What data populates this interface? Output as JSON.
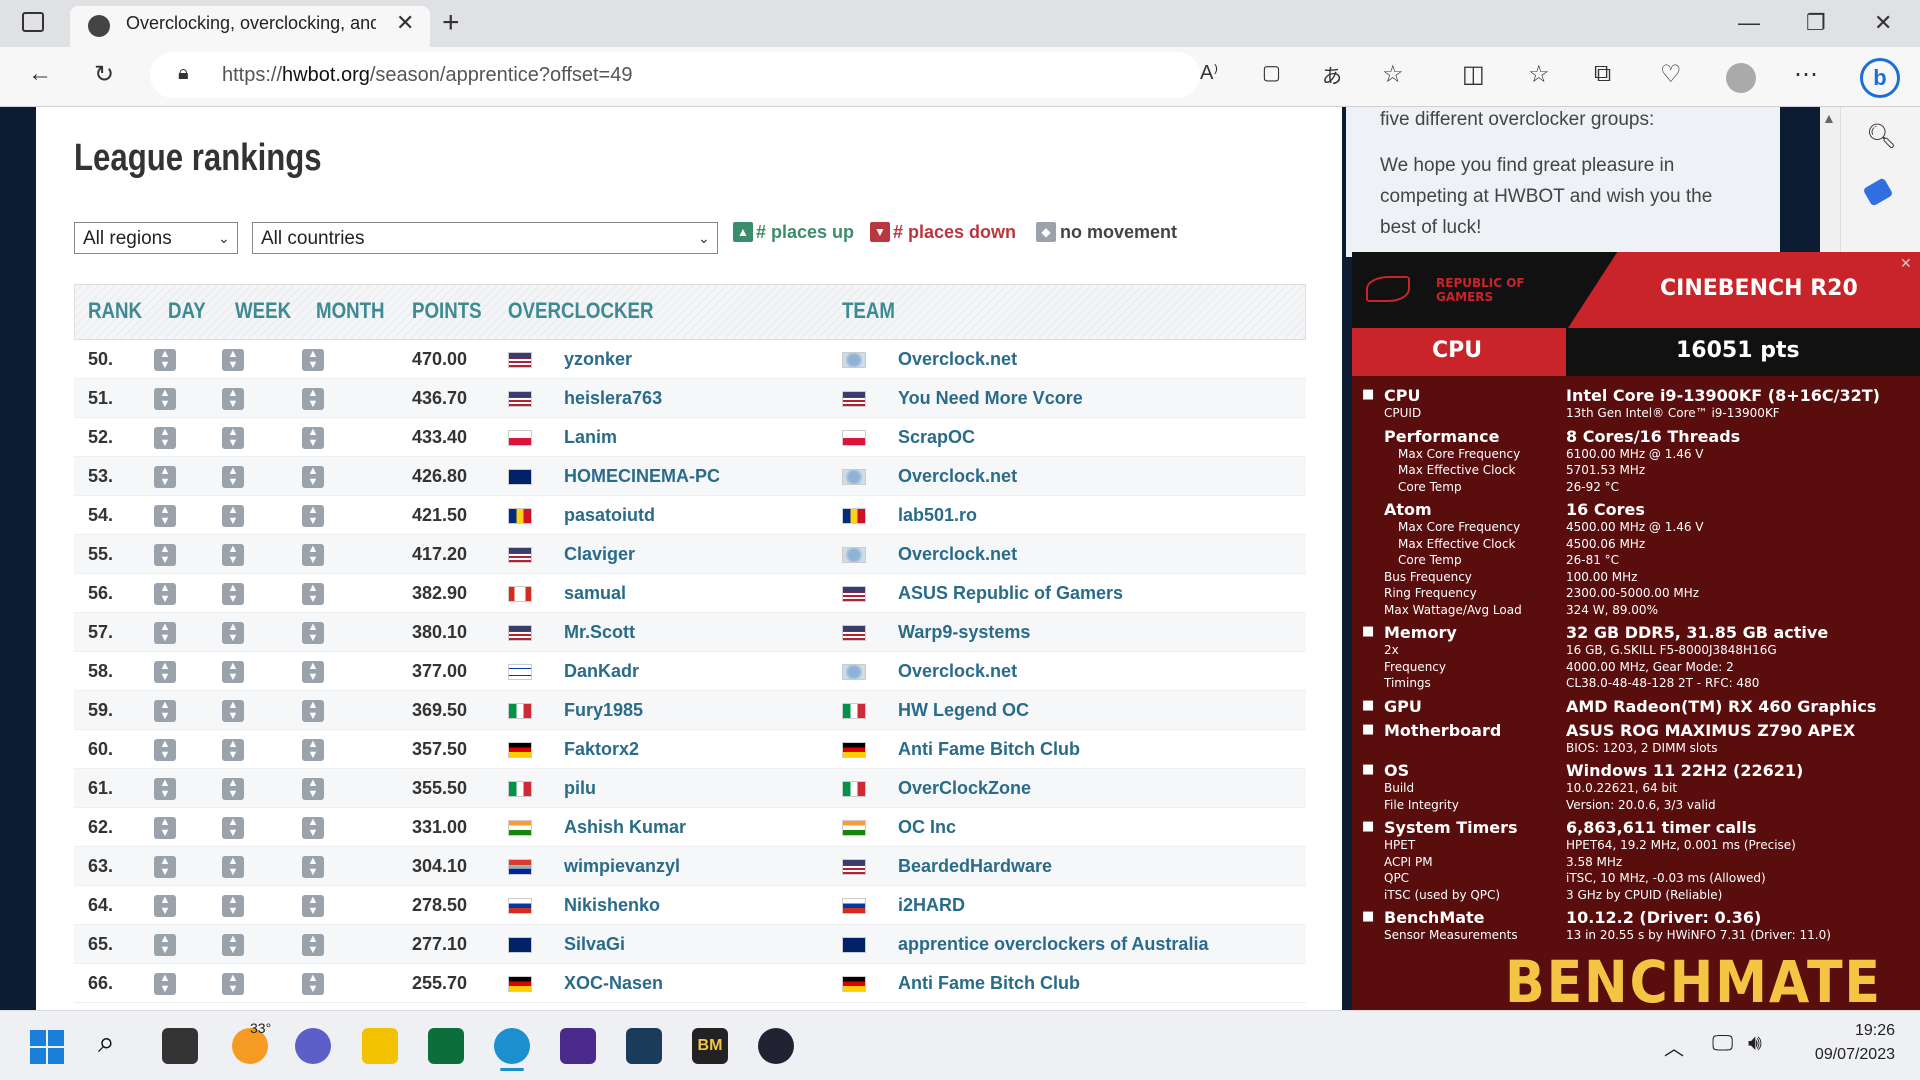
{
  "browser": {
    "tab_title": "Overclocking, overclocking, and more",
    "url_prefix": "https://",
    "url_domain": "hwbot.org",
    "url_path": "/season/apprentice?offset=49"
  },
  "page": {
    "title": "League rankings",
    "regions_select": "All regions",
    "countries_select": "All countries",
    "legend_up": "# places up",
    "legend_down": "# places down",
    "legend_none": "no movement",
    "right_text_1": "five different overclocker groups:",
    "right_text_2": "We hope you find great pleasure in",
    "right_text_3": "competing at HWBOT and wish you the",
    "right_text_4": "best of luck!"
  },
  "table": {
    "headers": {
      "rank": "RANK",
      "day": "DAY",
      "week": "WEEK",
      "month": "MONTH",
      "points": "POINTS",
      "overclocker": "OVERCLOCKER",
      "team": "TEAM"
    },
    "rows": [
      {
        "rank": "50.",
        "points": "470.00",
        "name": "yzonker",
        "team": "Overclock.net",
        "flag": "us",
        "tflag": "world"
      },
      {
        "rank": "51.",
        "points": "436.70",
        "name": "heislera763",
        "team": "You Need More Vcore",
        "flag": "us",
        "tflag": "us"
      },
      {
        "rank": "52.",
        "points": "433.40",
        "name": "Lanim",
        "team": "ScrapOC",
        "flag": "pl",
        "tflag": "pl"
      },
      {
        "rank": "53.",
        "points": "426.80",
        "name": "HOMECINEMA-PC",
        "team": "Overclock.net",
        "flag": "au",
        "tflag": "world"
      },
      {
        "rank": "54.",
        "points": "421.50",
        "name": "pasatoiutd",
        "team": "lab501.ro",
        "flag": "ro",
        "tflag": "ro"
      },
      {
        "rank": "55.",
        "points": "417.20",
        "name": "Claviger",
        "team": "Overclock.net",
        "flag": "us",
        "tflag": "world"
      },
      {
        "rank": "56.",
        "points": "382.90",
        "name": "samual",
        "team": "ASUS Republic of Gamers",
        "flag": "ca",
        "tflag": "us"
      },
      {
        "rank": "57.",
        "points": "380.10",
        "name": "Mr.Scott",
        "team": "Warp9-systems",
        "flag": "us",
        "tflag": "us"
      },
      {
        "rank": "58.",
        "points": "377.00",
        "name": "DanKadr",
        "team": "Overclock.net",
        "flag": "il",
        "tflag": "world"
      },
      {
        "rank": "59.",
        "points": "369.50",
        "name": "Fury1985",
        "team": "HW Legend OC",
        "flag": "it",
        "tflag": "it"
      },
      {
        "rank": "60.",
        "points": "357.50",
        "name": "Faktorx2",
        "team": "Anti Fame Bitch Club",
        "flag": "de",
        "tflag": "de"
      },
      {
        "rank": "61.",
        "points": "355.50",
        "name": "pilu",
        "team": "OverClockZone",
        "flag": "it",
        "tflag": "it"
      },
      {
        "rank": "62.",
        "points": "331.00",
        "name": "Ashish Kumar",
        "team": "OC Inc",
        "flag": "in",
        "tflag": "in"
      },
      {
        "rank": "63.",
        "points": "304.10",
        "name": "wimpievanzyl",
        "team": "BeardedHardware",
        "flag": "za",
        "tflag": "us"
      },
      {
        "rank": "64.",
        "points": "278.50",
        "name": "Nikishenko",
        "team": "i2HARD",
        "flag": "ru",
        "tflag": "ru"
      },
      {
        "rank": "65.",
        "points": "277.10",
        "name": "SilvaGi",
        "team": "apprentice overclockers of Australia",
        "flag": "au",
        "tflag": "au"
      },
      {
        "rank": "66.",
        "points": "255.70",
        "name": "XOC-Nasen",
        "team": "Anti Fame Bitch Club",
        "flag": "de",
        "tflag": "de"
      }
    ]
  },
  "benchmate": {
    "rog_line1": "REPUBLIC OF",
    "rog_line2": "GAMERS",
    "bench": "CINEBENCH R20",
    "cat": "CPU",
    "score": "16051 pts",
    "lines": [
      {
        "l": "CPU",
        "v": "Intel Core i9-13900KF (8+16C/32T)",
        "big": true,
        "icon": "cpu-icon"
      },
      {
        "l": "CPUID",
        "v": "13th Gen Intel® Core™ i9-13900KF",
        "big": false
      },
      {
        "l": "Performance",
        "v": "8 Cores/16 Threads",
        "big": true,
        "indent": 1
      },
      {
        "l": "Max Core Frequency",
        "v": "6100.00 MHz @ 1.46 V",
        "big": false,
        "indent": 2
      },
      {
        "l": "Max Effective Clock",
        "v": "5701.53 MHz",
        "big": false,
        "indent": 2
      },
      {
        "l": "Core Temp",
        "v": "26-92 °C",
        "big": false,
        "indent": 2
      },
      {
        "l": "Atom",
        "v": "16 Cores",
        "big": true,
        "indent": 1
      },
      {
        "l": "Max Core Frequency",
        "v": "4500.00 MHz @ 1.46 V",
        "big": false,
        "indent": 2
      },
      {
        "l": "Max Effective Clock",
        "v": "4500.06 MHz",
        "big": false,
        "indent": 2
      },
      {
        "l": "Core Temp",
        "v": "26-81 °C",
        "big": false,
        "indent": 2
      },
      {
        "l": "Bus Frequency",
        "v": "100.00 MHz",
        "big": false
      },
      {
        "l": "Ring Frequency",
        "v": "2300.00-5000.00 MHz",
        "big": false
      },
      {
        "l": "Max Wattage/Avg Load",
        "v": "324 W, 89.00%",
        "big": false
      },
      {
        "l": "Memory",
        "v": "32 GB DDR5, 31.85 GB active",
        "big": true,
        "icon": "memory-icon"
      },
      {
        "l": "2x",
        "v": "16 GB, G.SKILL F5-8000J3848H16G",
        "big": false
      },
      {
        "l": "Frequency",
        "v": "4000.00 MHz, Gear Mode: 2",
        "big": false
      },
      {
        "l": "Timings",
        "v": "CL38.0-48-48-128 2T - RFC: 480",
        "big": false
      },
      {
        "l": "GPU",
        "v": "AMD Radeon(TM) RX 460 Graphics",
        "big": true,
        "icon": "gpu-icon"
      },
      {
        "l": "Motherboard",
        "v": "ASUS ROG MAXIMUS Z790 APEX",
        "big": true,
        "icon": "motherboard-icon"
      },
      {
        "l": "",
        "v": "BIOS: 1203, 2 DIMM slots",
        "big": false
      },
      {
        "l": "OS",
        "v": "Windows 11 22H2 (22621)",
        "big": true,
        "icon": "windows-icon"
      },
      {
        "l": "Build",
        "v": "10.0.22621, 64 bit",
        "big": false
      },
      {
        "l": "File Integrity",
        "v": "Version: 20.0.6, 3/3 valid",
        "big": false
      },
      {
        "l": "System Timers",
        "v": "6,863,611 timer calls",
        "big": true,
        "icon": "clock-icon"
      },
      {
        "l": "HPET",
        "v": "HPET64, 19.2 MHz, 0.001 ms (Precise)",
        "big": false
      },
      {
        "l": "ACPI PM",
        "v": "3.58 MHz",
        "big": false
      },
      {
        "l": "QPC",
        "v": "iTSC, 10 MHz, -0.03 ms (Allowed)",
        "big": false
      },
      {
        "l": "iTSC (used by QPC)",
        "v": "3 GHz by CPUID (Reliable)",
        "big": false
      },
      {
        "l": "BenchMate",
        "v": "10.12.2 (Driver: 0.36)",
        "big": true,
        "icon": "benchmate-icon"
      },
      {
        "l": "Sensor Measurements",
        "v": "13 in 20.55 s by HWiNFO 7.31 (Driver: 11.0)",
        "big": false
      }
    ],
    "logo": "BENCHMATE"
  },
  "taskbar": {
    "weather": "33°",
    "time": "19:26",
    "date": "09/07/2023"
  }
}
